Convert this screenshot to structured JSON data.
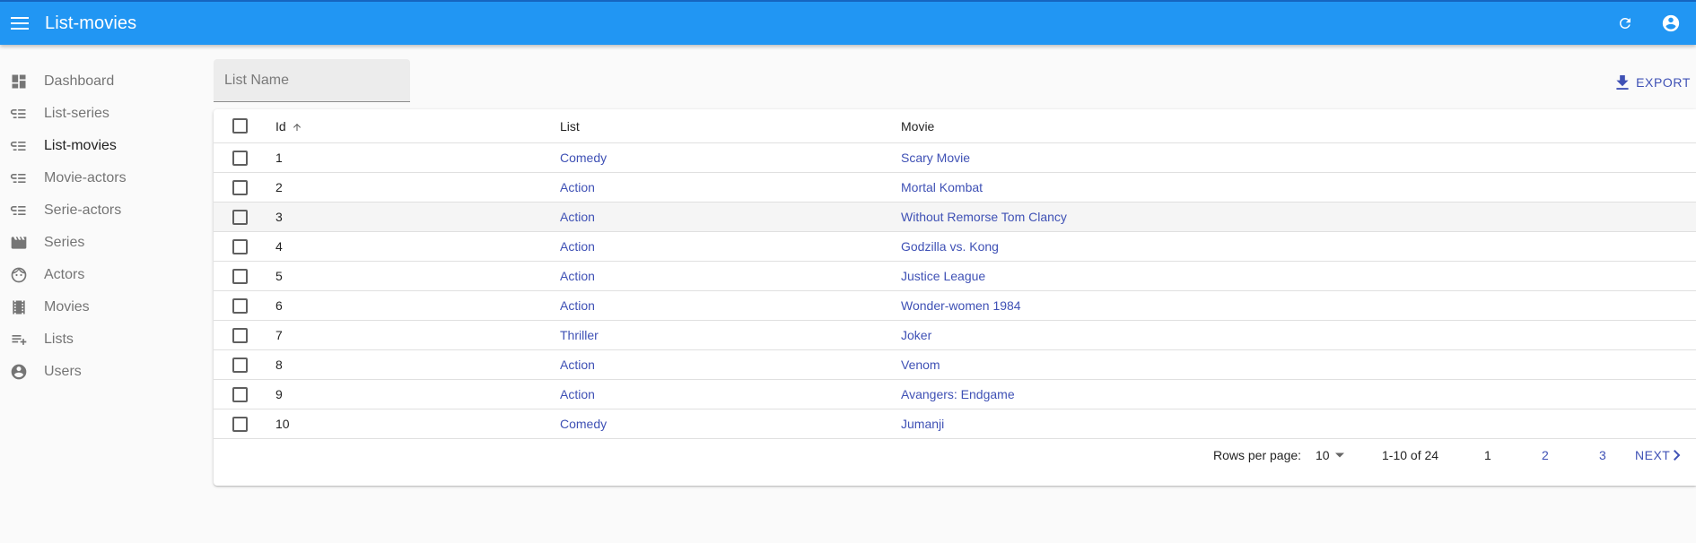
{
  "appbar": {
    "title": "List-movies"
  },
  "sidebar": {
    "items": [
      {
        "label": "Dashboard",
        "icon": "dashboard-icon"
      },
      {
        "label": "List-series",
        "icon": "list-icon"
      },
      {
        "label": "List-movies",
        "icon": "list-icon",
        "active": true
      },
      {
        "label": "Movie-actors",
        "icon": "list-icon"
      },
      {
        "label": "Serie-actors",
        "icon": "list-icon"
      },
      {
        "label": "Series",
        "icon": "movie-icon"
      },
      {
        "label": "Actors",
        "icon": "face-icon"
      },
      {
        "label": "Movies",
        "icon": "film-icon"
      },
      {
        "label": "Lists",
        "icon": "playlist-icon"
      },
      {
        "label": "Users",
        "icon": "account-circle-icon"
      }
    ]
  },
  "filter": {
    "placeholder": "List Name"
  },
  "toolbar": {
    "export_label": "EXPORT"
  },
  "table": {
    "columns": [
      "Id",
      "List",
      "Movie"
    ],
    "rows": [
      {
        "id": "1",
        "list": "Comedy",
        "movie": "Scary Movie"
      },
      {
        "id": "2",
        "list": "Action",
        "movie": "Mortal Kombat"
      },
      {
        "id": "3",
        "list": "Action",
        "movie": "Without Remorse Tom Clancy"
      },
      {
        "id": "4",
        "list": "Action",
        "movie": "Godzilla vs. Kong"
      },
      {
        "id": "5",
        "list": "Action",
        "movie": "Justice League"
      },
      {
        "id": "6",
        "list": "Action",
        "movie": "Wonder-women 1984"
      },
      {
        "id": "7",
        "list": "Thriller",
        "movie": "Joker"
      },
      {
        "id": "8",
        "list": "Action",
        "movie": "Venom"
      },
      {
        "id": "9",
        "list": "Action",
        "movie": "Avangers: Endgame"
      },
      {
        "id": "10",
        "list": "Comedy",
        "movie": "Jumanji"
      }
    ]
  },
  "pagination": {
    "rows_per_page_label": "Rows per page:",
    "rows_per_page": "10",
    "range": "1-10 of 24",
    "pages": [
      "1",
      "2",
      "3"
    ],
    "current_page": "1",
    "next_label": "NEXT"
  },
  "colors": {
    "appbar": "#2196f3",
    "link": "#3f51b5"
  }
}
